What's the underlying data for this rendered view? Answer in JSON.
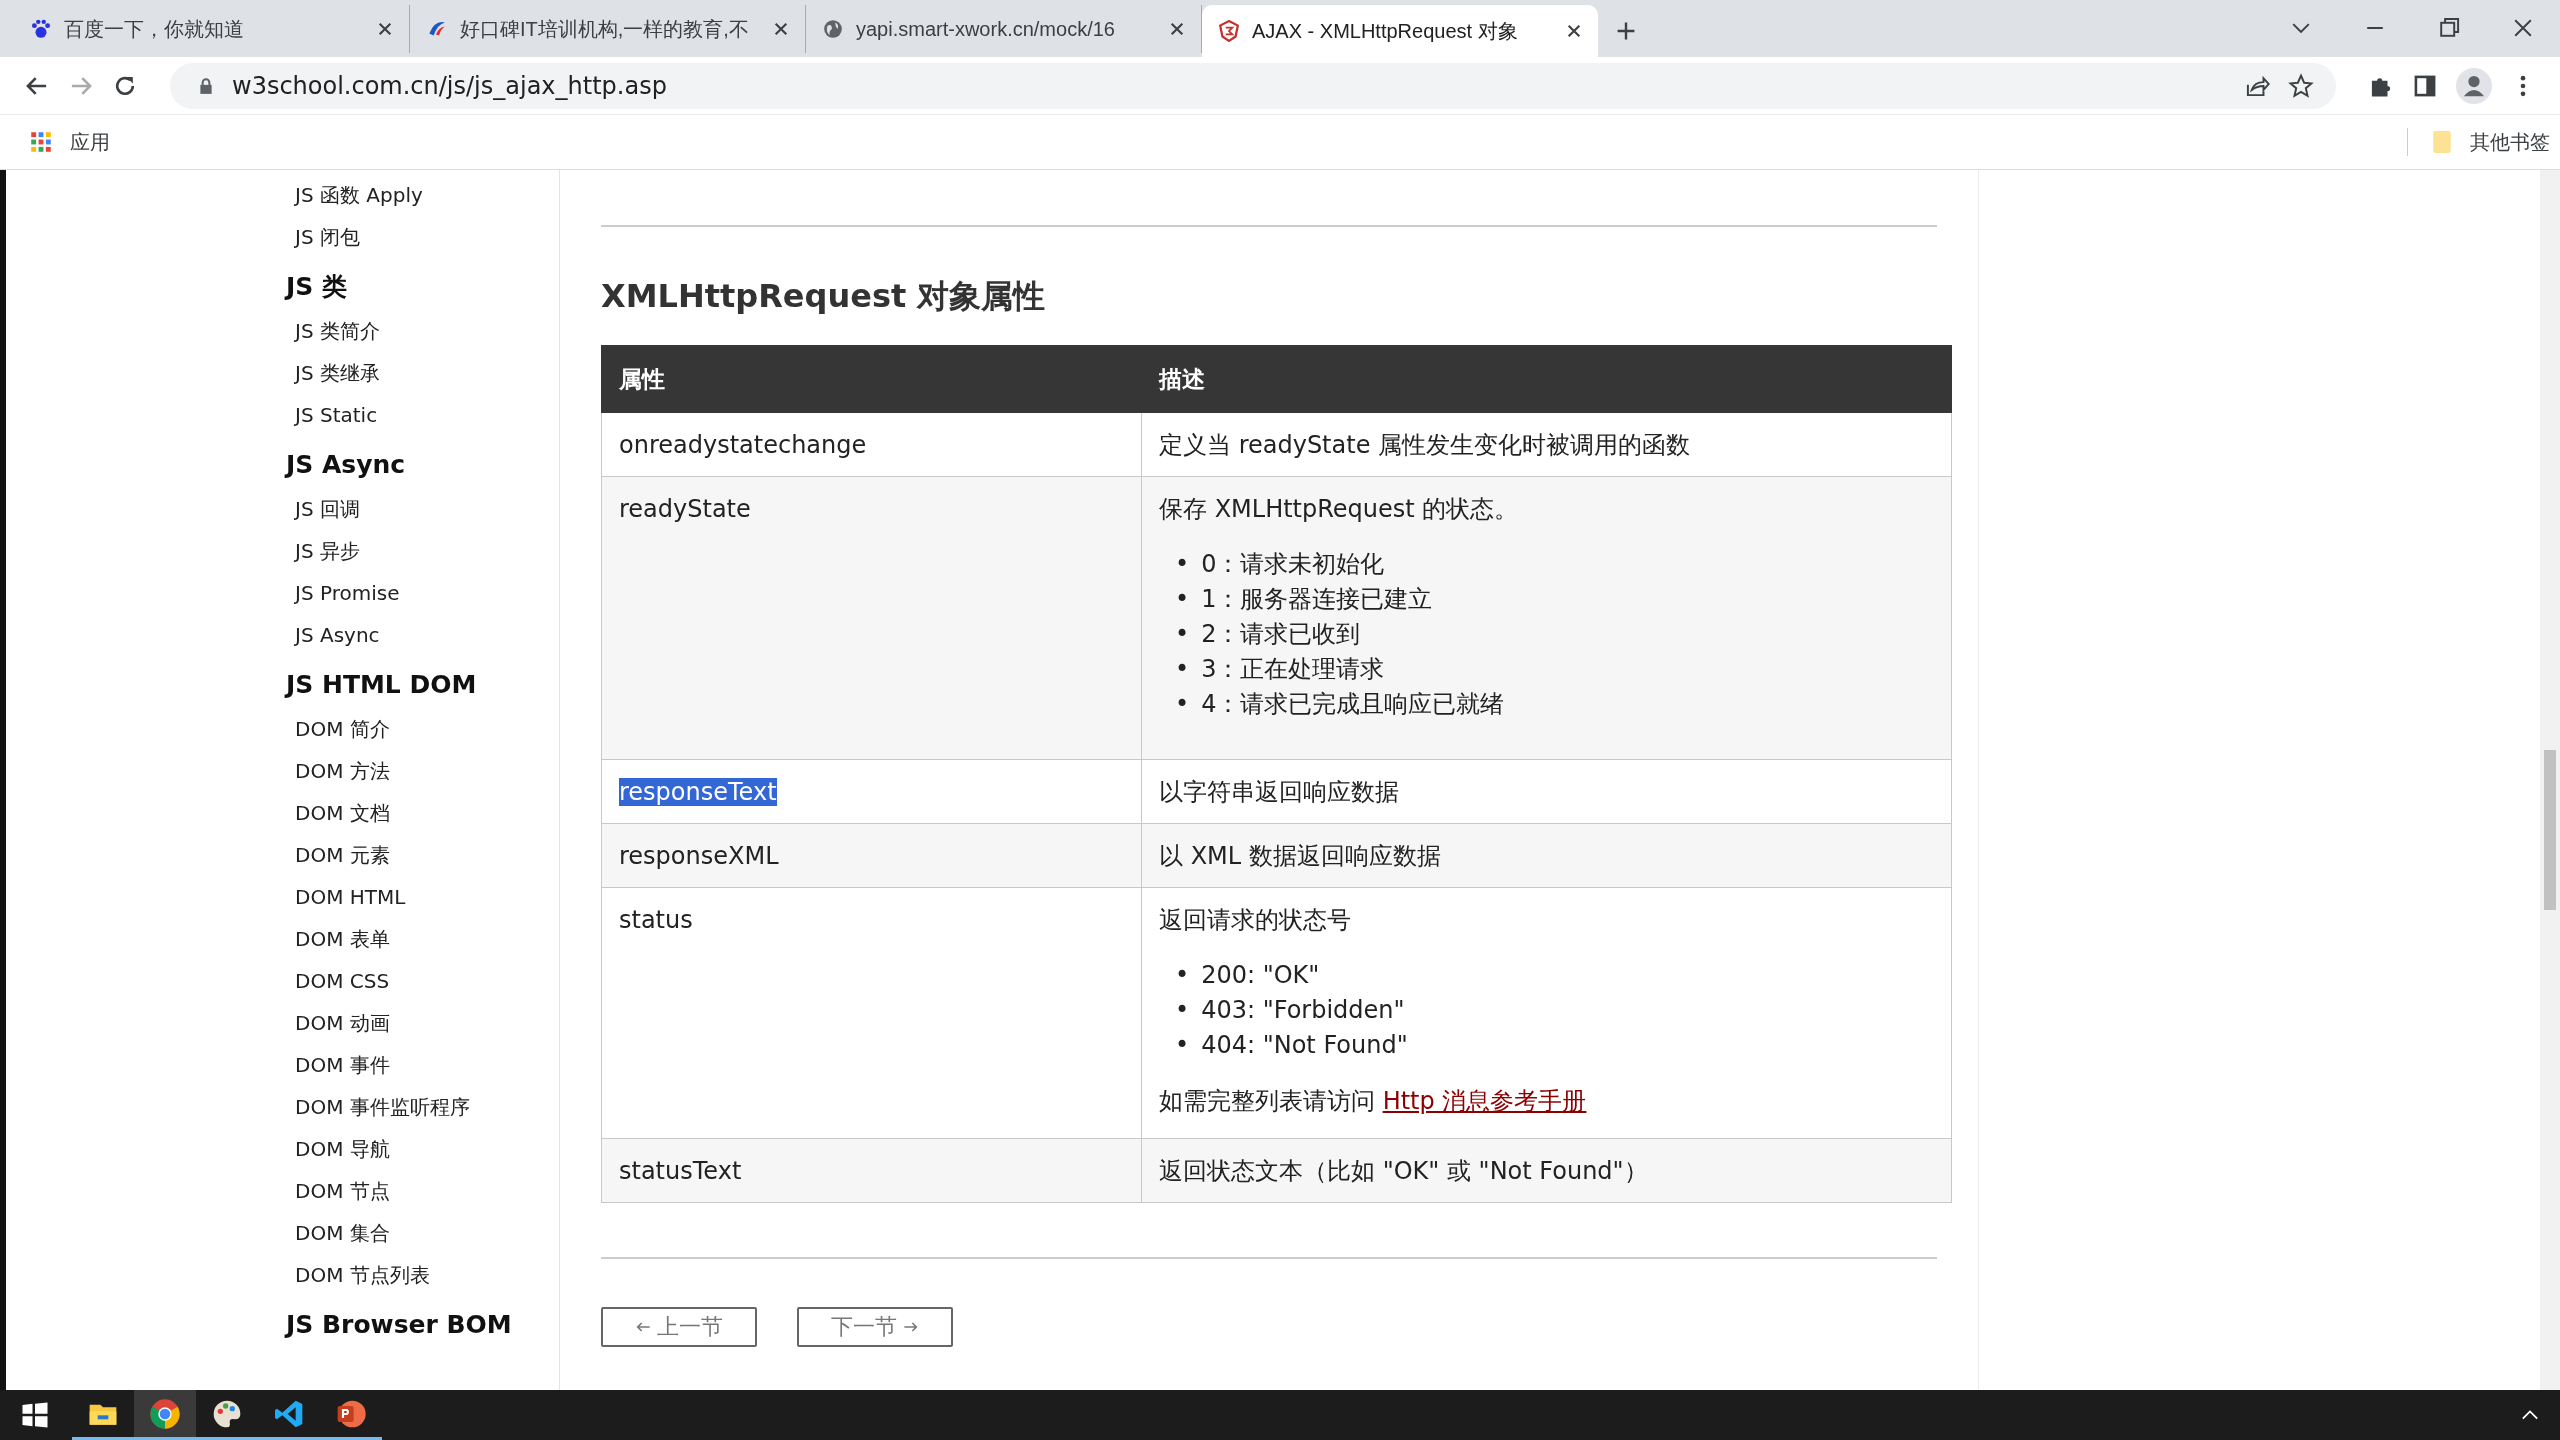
{
  "tabs": [
    {
      "title": "百度一下，你就知道",
      "selected": false
    },
    {
      "title": "好口碑IT培训机构,一样的教育,不",
      "selected": false
    },
    {
      "title": "yapi.smart-xwork.cn/mock/16",
      "selected": false
    },
    {
      "title": "AJAX - XMLHttpRequest 对象",
      "selected": true
    }
  ],
  "address": "w3school.com.cn/js/js_ajax_http.asp",
  "bookmarks": {
    "apps": "应用",
    "other": "其他书签"
  },
  "sidebar": [
    {
      "items": [
        "JS 函数 Apply",
        "JS 闭包"
      ]
    },
    {
      "heading": "JS 类",
      "items": [
        "JS 类简介",
        "JS 类继承",
        "JS Static"
      ]
    },
    {
      "heading": "JS Async",
      "items": [
        "JS 回调",
        "JS 异步",
        "JS Promise",
        "JS Async"
      ]
    },
    {
      "heading": "JS HTML DOM",
      "items": [
        "DOM 简介",
        "DOM 方法",
        "DOM 文档",
        "DOM 元素",
        "DOM HTML",
        "DOM 表单",
        "DOM CSS",
        "DOM 动画",
        "DOM 事件",
        "DOM 事件监听程序",
        "DOM 导航",
        "DOM 节点",
        "DOM 集合",
        "DOM 节点列表"
      ]
    },
    {
      "heading": "JS Browser BOM"
    }
  ],
  "heading": "XMLHttpRequest 对象属性",
  "table": {
    "columns": [
      "属性",
      "描述"
    ],
    "rows": [
      {
        "property": "onreadystatechange",
        "highlighted": false,
        "description": {
          "text": "定义当 readyState 属性发生变化时被调用的函数"
        }
      },
      {
        "property": "readyState",
        "highlighted": false,
        "description": {
          "text": "保存 XMLHttpRequest 的状态。",
          "marker": "•",
          "items": [
            "0：请求未初始化",
            "1：服务器连接已建立",
            "2：请求已收到",
            "3：正在处理请求",
            "4：请求已完成且响应已就绪"
          ]
        }
      },
      {
        "property": "responseText",
        "highlighted": true,
        "description": {
          "text": "以字符串返回响应数据"
        }
      },
      {
        "property": "responseXML",
        "highlighted": false,
        "description": {
          "text": "以 XML 数据返回响应数据"
        }
      },
      {
        "property": "status",
        "highlighted": false,
        "description": {
          "text": "返回请求的状态号",
          "marker": "•",
          "items": [
            "200: \"OK\"",
            "403: \"Forbidden\"",
            "404: \"Not Found\""
          ],
          "note": "如需完整列表请访问",
          "link": "Http 消息参考手册"
        }
      },
      {
        "property": "statusText",
        "highlighted": false,
        "description": {
          "text": "返回状态文本（比如 \"OK\" 或 \"Not Found\"）"
        }
      }
    ]
  },
  "nav": {
    "prev": "上一节",
    "next": "下一节"
  },
  "taskbar": [
    {
      "kind": "explorer",
      "selected": false
    },
    {
      "kind": "chrome",
      "selected": true
    },
    {
      "kind": "paint",
      "selected": false
    },
    {
      "kind": "vscode",
      "selected": false
    },
    {
      "kind": "powerpoint",
      "selected": false
    }
  ]
}
